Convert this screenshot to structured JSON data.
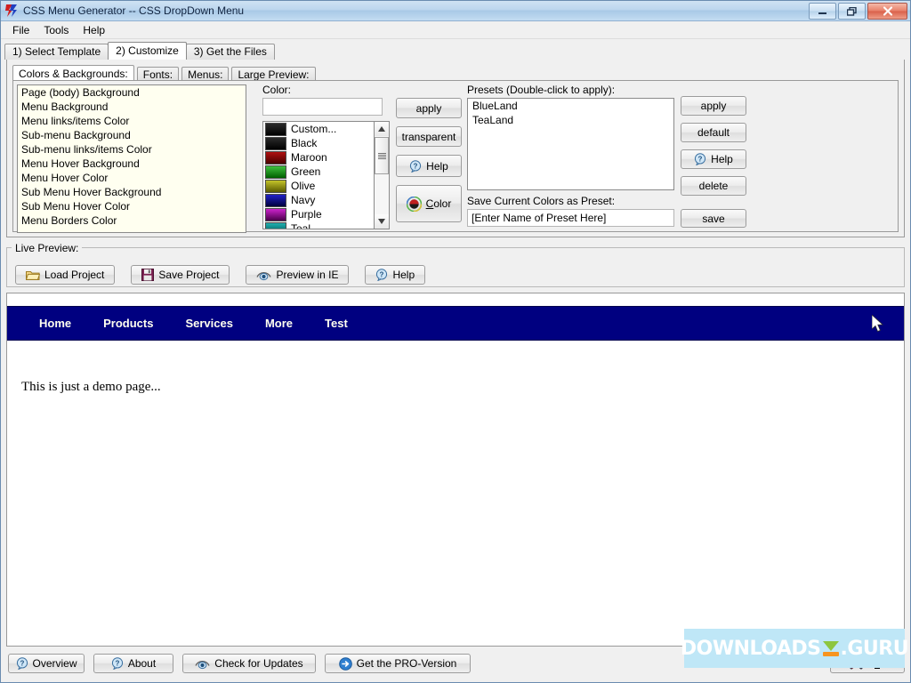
{
  "window": {
    "title": "CSS Menu Generator -- CSS DropDown Menu",
    "icon": "app-bolt-icon",
    "controls": {
      "minimize": "minimize-icon",
      "restore": "restore-icon",
      "close": "close-icon"
    }
  },
  "menubar": {
    "items": [
      "File",
      "Tools",
      "Help"
    ]
  },
  "tabs": {
    "items": [
      {
        "label": "1) Select Template",
        "active": false
      },
      {
        "label": "2) Customize",
        "active": true
      },
      {
        "label": "3) Get the Files",
        "active": false
      }
    ]
  },
  "subtabs": {
    "items": [
      {
        "label": "Colors & Backgrounds:",
        "active": true
      },
      {
        "label": "Fonts:",
        "active": false
      },
      {
        "label": "Menus:",
        "active": false
      },
      {
        "label": "Large Preview:",
        "active": false
      }
    ]
  },
  "properties": {
    "items": [
      "Page (body) Background",
      "Menu Background",
      "Menu links/items Color",
      "Sub-menu Background",
      "Sub-menu links/items Color",
      "Menu Hover Background",
      "Menu Hover Color",
      "Sub Menu Hover Background",
      "Sub Menu Hover Color",
      "Menu Borders Color"
    ]
  },
  "color_section": {
    "label": "Color:",
    "value": "",
    "placeholder": "",
    "list": [
      {
        "name": "Custom...",
        "hex": "#000000"
      },
      {
        "name": "Black",
        "hex": "#000000"
      },
      {
        "name": "Maroon",
        "hex": "#800000"
      },
      {
        "name": "Green",
        "hex": "#008000"
      },
      {
        "name": "Olive",
        "hex": "#808000"
      },
      {
        "name": "Navy",
        "hex": "#000080"
      },
      {
        "name": "Purple",
        "hex": "#800080"
      },
      {
        "name": "Teal",
        "hex": "#008080"
      }
    ],
    "buttons": [
      {
        "label": "apply",
        "icon": ""
      },
      {
        "label": "transparent",
        "icon": ""
      },
      {
        "label": "Help",
        "icon": "help-icon"
      },
      {
        "label": "Color",
        "icon": "color-wheel-icon"
      }
    ]
  },
  "presets": {
    "label": "Presets (Double-click to apply):",
    "items": [
      "BlueLand",
      "TeaLand"
    ],
    "buttons": [
      {
        "label": "apply",
        "icon": ""
      },
      {
        "label": "default",
        "icon": ""
      },
      {
        "label": "Help",
        "icon": "help-icon"
      },
      {
        "label": "delete",
        "icon": ""
      }
    ],
    "save_label": "Save Current Colors as Preset:",
    "save_value": "[Enter Name of Preset Here]",
    "save_button": "save"
  },
  "live_preview": {
    "label": "Live Preview:",
    "buttons": [
      {
        "label": "Load Project",
        "icon": "folder-open-icon"
      },
      {
        "label": "Save Project",
        "icon": "floppy-disk-icon"
      },
      {
        "label": "Preview in IE",
        "icon": "eye-icon"
      },
      {
        "label": "Help",
        "icon": "help-icon"
      }
    ]
  },
  "preview": {
    "menu_items": [
      "Home",
      "Products",
      "Services",
      "More",
      "Test"
    ],
    "menu_background": "#000080",
    "menu_text_color": "#FFFFF0",
    "body_text": "This is just a demo page...",
    "cursor": "arrow-cursor"
  },
  "bottom_bar": {
    "buttons": [
      {
        "label": "Overview",
        "icon": "help-icon"
      },
      {
        "label": "About",
        "icon": "help-icon"
      },
      {
        "label": "Check for Updates",
        "icon": "eye-icon"
      },
      {
        "label": "Get the PRO-Version",
        "icon": "arrow-right-circle-icon"
      }
    ],
    "exit": {
      "label": "Exit",
      "icon": "x-cross-icon"
    }
  },
  "watermark": {
    "text_left": "DOWNLOADS",
    "text_right": ".GURU",
    "logo": "leaf-logo-icon"
  }
}
